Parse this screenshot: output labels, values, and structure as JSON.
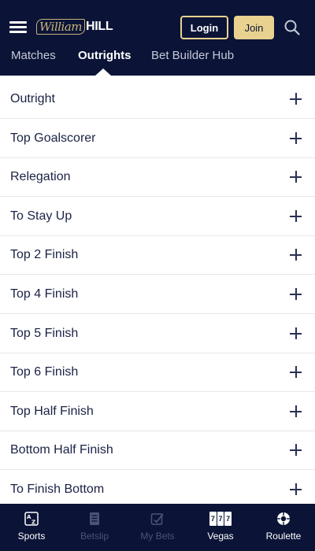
{
  "header": {
    "logo_script": "William",
    "logo_block": "HILL",
    "login_label": "Login",
    "join_label": "Join",
    "colors": {
      "background": "#0b1437",
      "accent_gold": "#e9d28f"
    },
    "icons": {
      "menu": "hamburger-menu-icon",
      "search": "search-icon"
    }
  },
  "tabs": [
    {
      "label": "Matches",
      "active": false
    },
    {
      "label": "Outrights",
      "active": true
    },
    {
      "label": "Bet Builder Hub",
      "active": false
    }
  ],
  "markets": [
    {
      "label": "Outright"
    },
    {
      "label": "Top Goalscorer"
    },
    {
      "label": "Relegation"
    },
    {
      "label": "To Stay Up"
    },
    {
      "label": "Top 2 Finish"
    },
    {
      "label": "Top 4 Finish"
    },
    {
      "label": "Top 5 Finish"
    },
    {
      "label": "Top 6 Finish"
    },
    {
      "label": "Top Half Finish"
    },
    {
      "label": "Bottom Half Finish"
    },
    {
      "label": "To Finish Bottom"
    }
  ],
  "bottom_nav": [
    {
      "label": "Sports",
      "icon": "sports-az-icon",
      "enabled": true
    },
    {
      "label": "Betslip",
      "icon": "betslip-icon",
      "enabled": false
    },
    {
      "label": "My Bets",
      "icon": "my-bets-icon",
      "enabled": false
    },
    {
      "label": "Vegas",
      "icon": "slot-machine-icon",
      "enabled": true
    },
    {
      "label": "Roulette",
      "icon": "roulette-wheel-icon",
      "enabled": true
    }
  ]
}
